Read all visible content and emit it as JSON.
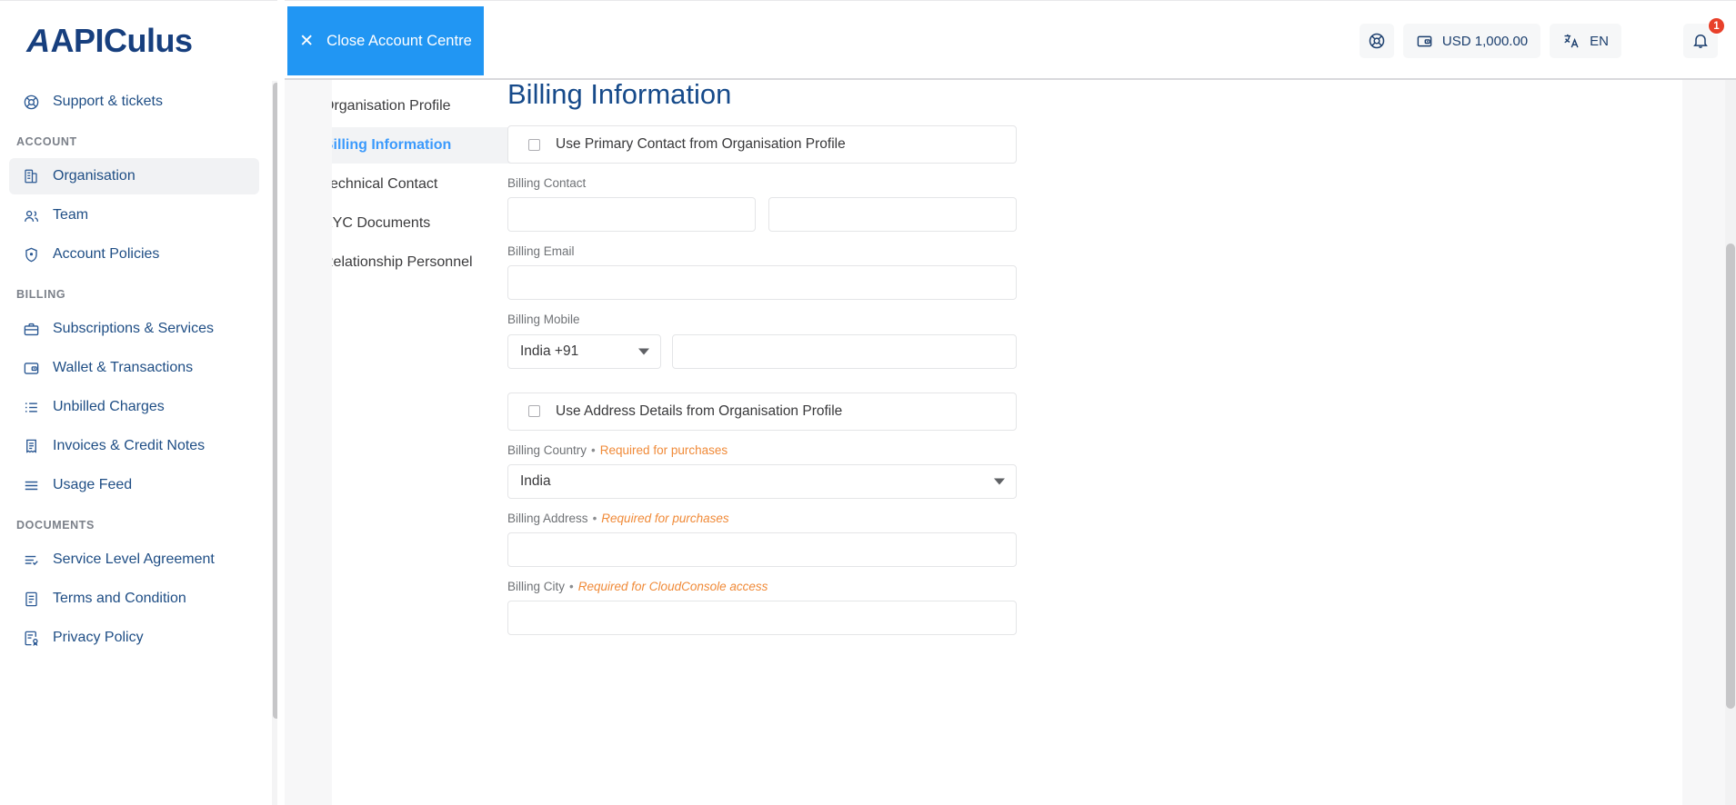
{
  "brand": {
    "name_part1": "APIC",
    "name_part2": "ulus",
    "full": "APICulus"
  },
  "header": {
    "close_button": {
      "label": "Close Account Centre",
      "icon": "close-icon",
      "bg": "#2196f3"
    },
    "help_icon": "lifebuoy-icon",
    "wallet": {
      "icon": "wallet-icon",
      "amount": "USD 1,000.00"
    },
    "language": {
      "icon": "translate-icon",
      "value": "EN"
    },
    "notifications": {
      "icon": "bell-icon",
      "count": "1",
      "badge_color": "#e8402a"
    }
  },
  "sidebar": {
    "items": [
      {
        "label": "Support & tickets",
        "icon": "lifebuoy-icon",
        "active": false
      },
      {
        "group": "ACCOUNT"
      },
      {
        "label": "Organisation",
        "icon": "building-icon",
        "active": true
      },
      {
        "label": "Team",
        "icon": "people-icon",
        "active": false
      },
      {
        "label": "Account Policies",
        "icon": "shield-icon",
        "active": false
      },
      {
        "group": "BILLING"
      },
      {
        "label": "Subscriptions & Services",
        "icon": "briefcase-icon",
        "active": false
      },
      {
        "label": "Wallet & Transactions",
        "icon": "wallet-icon",
        "active": false
      },
      {
        "label": "Unbilled Charges",
        "icon": "list-icon",
        "active": false
      },
      {
        "label": "Invoices & Credit Notes",
        "icon": "invoice-icon",
        "active": false
      },
      {
        "label": "Usage Feed",
        "icon": "lines-icon",
        "active": false
      },
      {
        "group": "DOCUMENTS"
      },
      {
        "label": "Service Level Agreement",
        "icon": "list-check-icon",
        "active": false
      },
      {
        "label": "Terms and Condition",
        "icon": "document-icon",
        "active": false
      },
      {
        "label": "Privacy Policy",
        "icon": "document-lock-icon",
        "active": false
      }
    ],
    "labels": {
      "support": "Support & tickets",
      "group_account": "ACCOUNT",
      "organisation": "Organisation",
      "team": "Team",
      "account_policies": "Account Policies",
      "group_billing": "BILLING",
      "subscriptions": "Subscriptions & Services",
      "wallet": "Wallet & Transactions",
      "unbilled": "Unbilled Charges",
      "invoices": "Invoices & Credit Notes",
      "usage_feed": "Usage Feed",
      "group_documents": "DOCUMENTS",
      "sla": "Service Level Agreement",
      "terms": "Terms and Condition",
      "privacy": "Privacy Policy"
    }
  },
  "subnav": {
    "items": [
      {
        "label": "Organisation Profile",
        "active": false
      },
      {
        "label": "Billing Information",
        "active": true
      },
      {
        "label": "Technical Contact",
        "active": false
      },
      {
        "label": "KYC Documents",
        "active": false
      },
      {
        "label": "Relationship Personnel",
        "active": false
      }
    ],
    "labels": {
      "organisation_profile": "Organisation Profile",
      "billing_information": "Billing Information",
      "technical_contact": "Technical Contact",
      "kyc_documents": "KYC Documents",
      "relationship_personnel": "Relationship Personnel"
    },
    "active_color": "#3b9afc"
  },
  "main": {
    "title": "Billing Information",
    "title_color": "#164a8a",
    "use_primary_contact": {
      "label": "Use Primary Contact from Organisation Profile",
      "checked": false
    },
    "use_address_details": {
      "label": "Use Address Details from Organisation Profile",
      "checked": false
    },
    "fields": {
      "billing_contact": {
        "label": "Billing Contact",
        "value_first": "",
        "value_last": "",
        "placeholder_first": "",
        "placeholder_last": ""
      },
      "billing_email": {
        "label": "Billing Email",
        "value": "",
        "placeholder": ""
      },
      "billing_mobile": {
        "label": "Billing Mobile",
        "country_code": "India +91",
        "value": "",
        "placeholder": ""
      },
      "billing_country": {
        "label": "Billing Country",
        "separator": "•",
        "hint": "Required for purchases",
        "hint_italic": false,
        "value": "India"
      },
      "billing_address": {
        "label": "Billing Address",
        "separator": "•",
        "hint": "Required for purchases",
        "hint_italic": true,
        "value": "",
        "placeholder": ""
      },
      "billing_city": {
        "label": "Billing City",
        "separator": "•",
        "hint": "Required for CloudConsole access",
        "hint_italic": true,
        "value": "",
        "placeholder": ""
      }
    },
    "hint_color": "#f08a38"
  }
}
